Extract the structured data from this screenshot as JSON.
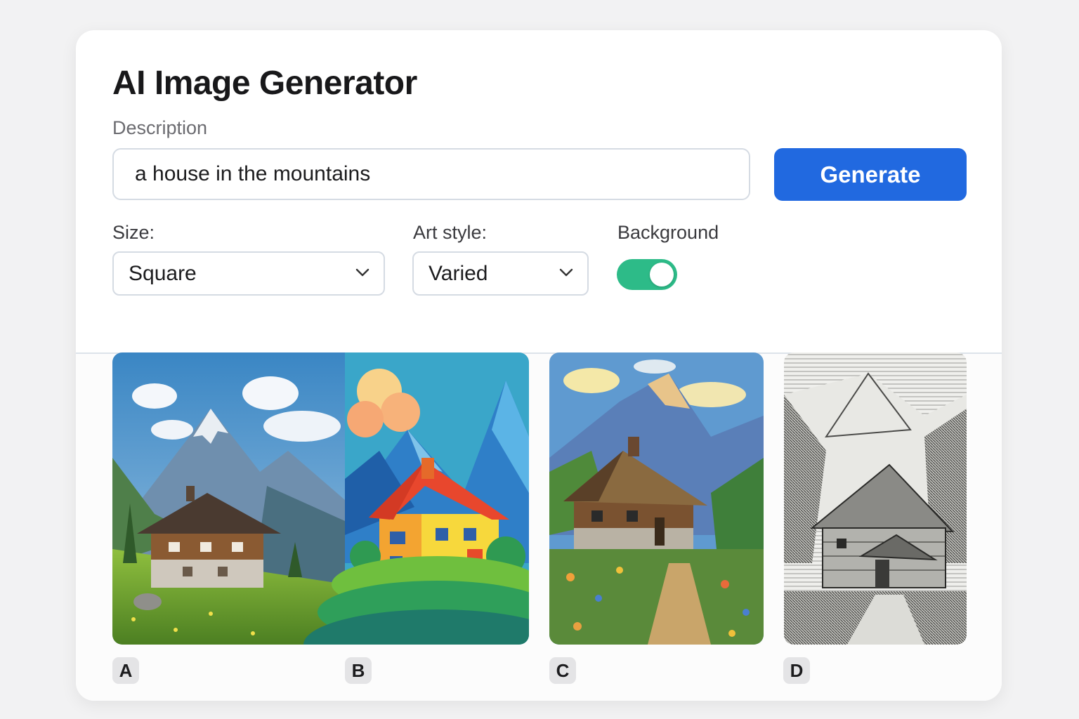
{
  "app": {
    "title": "AI Image Generator"
  },
  "prompt": {
    "label": "Description",
    "value": "a house in the mountains"
  },
  "generate": {
    "label": "Generate"
  },
  "options": {
    "size": {
      "label": "Size:",
      "value": "Square"
    },
    "style": {
      "label": "Art style:",
      "value": "Varied"
    },
    "background": {
      "label": "Background",
      "enabled": true
    }
  },
  "results": [
    {
      "label": "A",
      "style": "realistic painting",
      "icon": "chalet-photo"
    },
    {
      "label": "B",
      "style": "flat illustration",
      "icon": "flat-house"
    },
    {
      "label": "C",
      "style": "impressionist painting",
      "icon": "impressionist-cabin"
    },
    {
      "label": "D",
      "style": "engraving",
      "icon": "engraved-barn"
    }
  ],
  "colors": {
    "accent": "#2169e0",
    "toggle_on": "#2dbb88",
    "badge_bg": "#e4e4e6"
  }
}
